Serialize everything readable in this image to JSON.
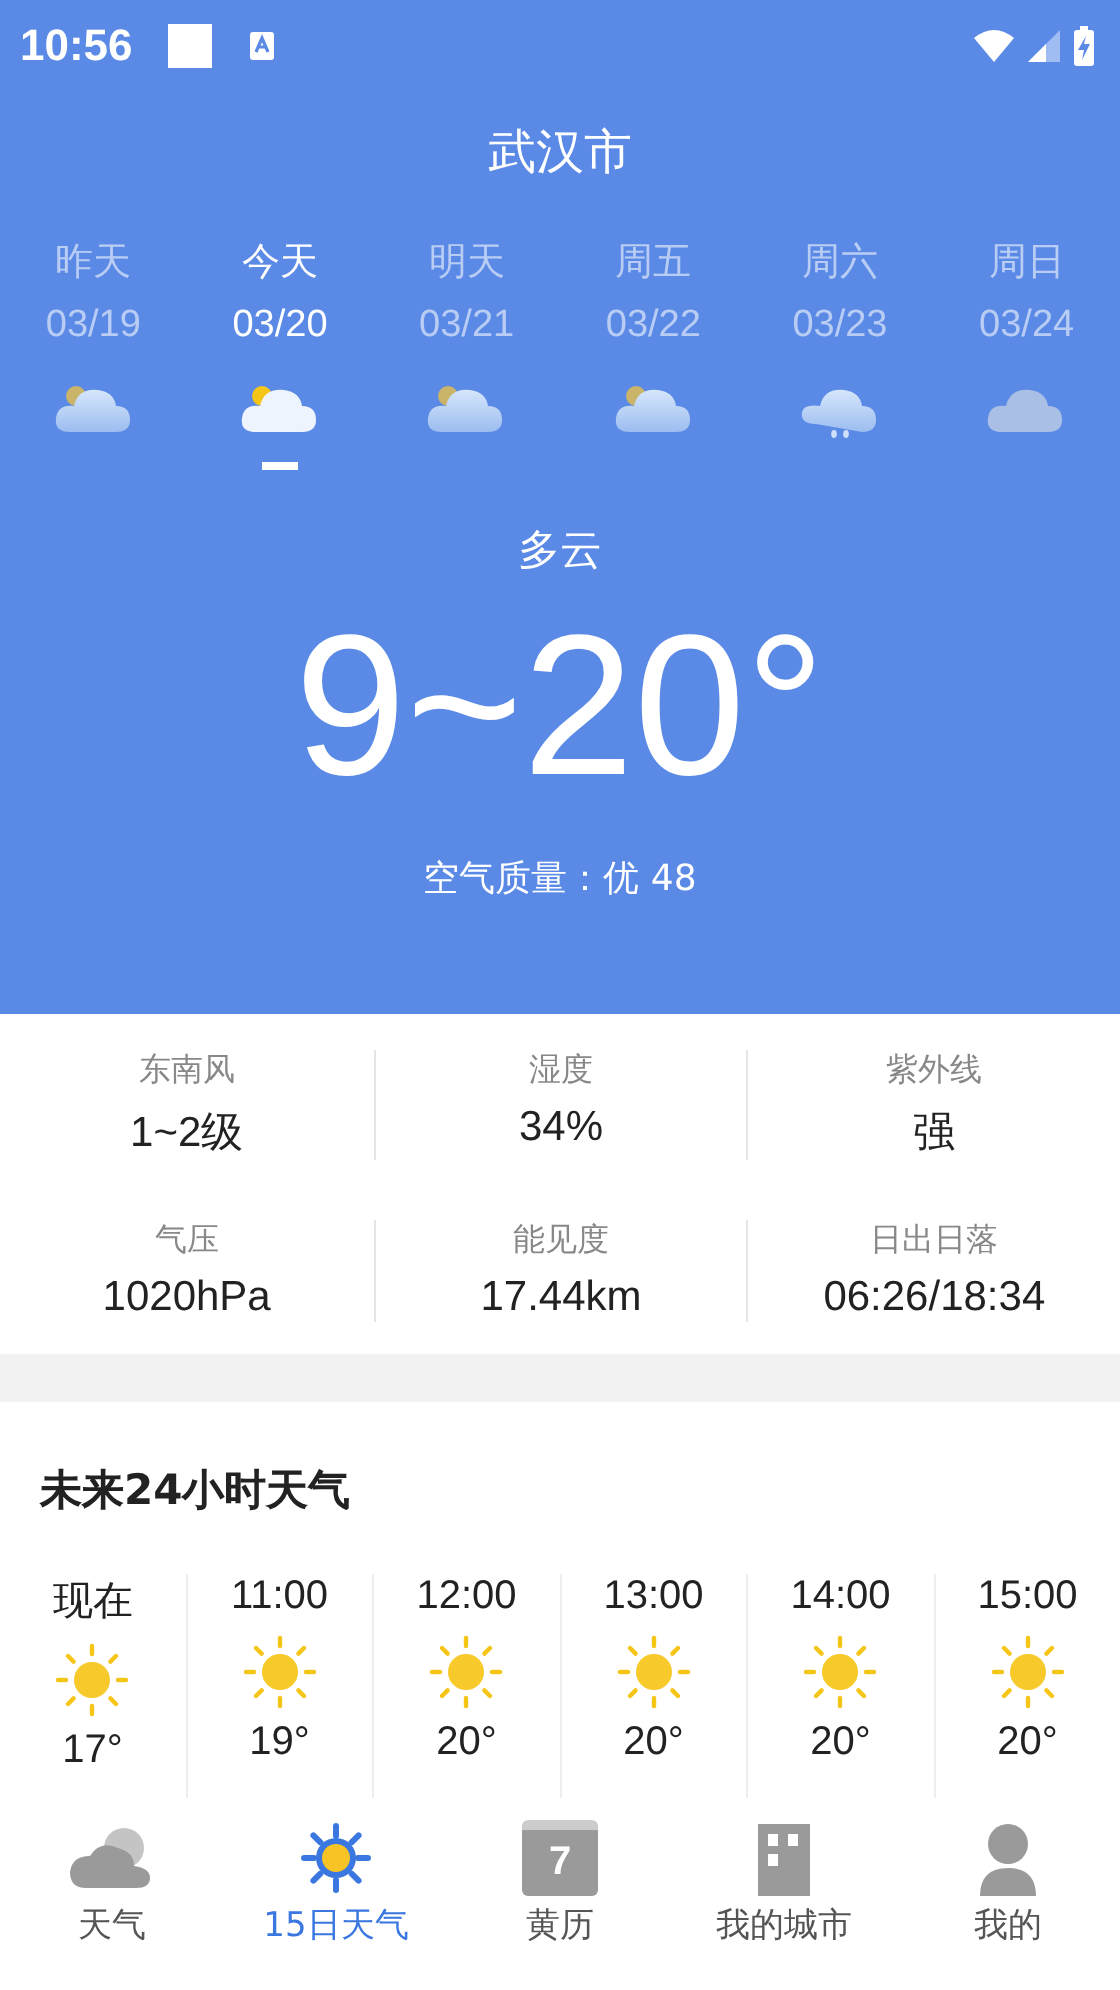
{
  "status_bar": {
    "time": "10:56"
  },
  "city": "武汉市",
  "days": [
    {
      "label": "昨天",
      "date": "03/19",
      "kind": "partly_cloudy",
      "selected": false
    },
    {
      "label": "今天",
      "date": "03/20",
      "kind": "partly_cloudy",
      "selected": true
    },
    {
      "label": "明天",
      "date": "03/21",
      "kind": "partly_cloudy",
      "selected": false
    },
    {
      "label": "周五",
      "date": "03/22",
      "kind": "partly_cloudy",
      "selected": false
    },
    {
      "label": "周六",
      "date": "03/23",
      "kind": "rain",
      "selected": false
    },
    {
      "label": "周日",
      "date": "03/24",
      "kind": "cloudy",
      "selected": false
    }
  ],
  "condition": "多云",
  "temperature": "9~20°",
  "air_quality": "空气质量：优 48",
  "details": [
    {
      "label": "东南风",
      "value": "1~2级"
    },
    {
      "label": "湿度",
      "value": "34%"
    },
    {
      "label": "紫外线",
      "value": "强"
    },
    {
      "label": "气压",
      "value": "1020hPa"
    },
    {
      "label": "能见度",
      "value": "17.44km"
    },
    {
      "label": "日出日落",
      "value": "06:26/18:34"
    }
  ],
  "hourly": {
    "title": "未来24小时天气",
    "items": [
      {
        "time": "现在",
        "kind": "sunny",
        "temp": "17°"
      },
      {
        "time": "11:00",
        "kind": "sunny",
        "temp": "19°"
      },
      {
        "time": "12:00",
        "kind": "sunny",
        "temp": "20°"
      },
      {
        "time": "13:00",
        "kind": "sunny",
        "temp": "20°"
      },
      {
        "time": "14:00",
        "kind": "sunny",
        "temp": "20°"
      },
      {
        "time": "15:00",
        "kind": "sunny",
        "temp": "20°"
      }
    ]
  },
  "tabs": [
    {
      "label": "天气",
      "kind": "cloud",
      "selected": false
    },
    {
      "label": "15日天气",
      "kind": "sun",
      "selected": true
    },
    {
      "label": "黄历",
      "kind": "calendar",
      "icon_text": "7",
      "selected": false
    },
    {
      "label": "我的城市",
      "kind": "building",
      "selected": false
    },
    {
      "label": "我的",
      "kind": "person",
      "selected": false
    }
  ]
}
